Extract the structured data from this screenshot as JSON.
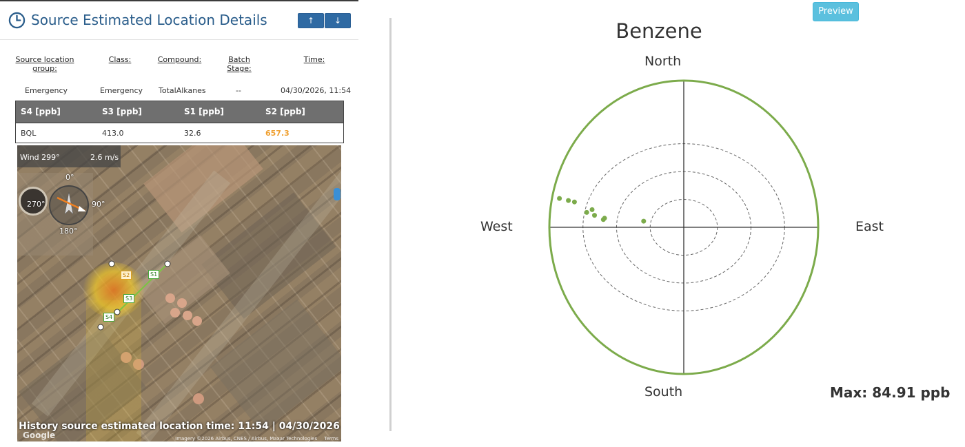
{
  "panel": {
    "title": "Source Estimated Location Details",
    "sort_up_label": "↑",
    "sort_down_label": "↓",
    "columns": {
      "source_group": "Source location group:",
      "class": "Class:",
      "compound": "Compound:",
      "batch_stage": "Batch Stage:",
      "time": "Time:"
    },
    "values": {
      "source_group": "Emergency",
      "class": "Emergency",
      "compound": "TotalAlkanes",
      "batch_stage": "--",
      "time": "04/30/2026, 11:54"
    },
    "sensor_table": {
      "headers": [
        "S4 [ppb]",
        "S3 [ppb]",
        "S1 [ppb]",
        "S2 [ppb]"
      ],
      "values": [
        "BQL",
        "413.0",
        "32.6",
        "657.3"
      ],
      "highlight_color": "#f0a030"
    }
  },
  "map": {
    "wind_label": "Wind 299°",
    "wind_speed": "2.6 m/s",
    "compass": {
      "n": "0°",
      "e": "90°",
      "s": "180°",
      "w": "270°"
    },
    "sensors": [
      "S1",
      "S2",
      "S3",
      "S4"
    ],
    "caption": "History source estimated location time: 11:54 | 04/30/2026",
    "attribution": "Imagery ©2026 Airbus, CNES / Airbus, Maxar Technologies",
    "terms": "Terms",
    "google": "Google"
  },
  "preview_label": "Preview",
  "polar": {
    "title": "Benzene",
    "north": "North",
    "south": "South",
    "east": "East",
    "west": "West",
    "max_label": "Max: 84.91 ppb",
    "accent_color": "#7cab4b"
  },
  "chart_data": {
    "type": "scatter",
    "title": "Benzene",
    "coordinate_system": "polar",
    "direction_labels": [
      "North",
      "East",
      "South",
      "West"
    ],
    "radial_max": 84.91,
    "radial_rings": 4,
    "points": [
      {
        "bearing_deg": 282,
        "value": 80.3
      },
      {
        "bearing_deg": 282,
        "value": 74.5
      },
      {
        "bearing_deg": 282,
        "value": 70.6
      },
      {
        "bearing_deg": 280,
        "value": 58.8
      },
      {
        "bearing_deg": 278,
        "value": 61.9
      },
      {
        "bearing_deg": 277,
        "value": 56.8
      },
      {
        "bearing_deg": 275,
        "value": 51.0
      },
      {
        "bearing_deg": 276,
        "value": 50.3
      },
      {
        "bearing_deg": 278,
        "value": 25.6
      }
    ]
  }
}
